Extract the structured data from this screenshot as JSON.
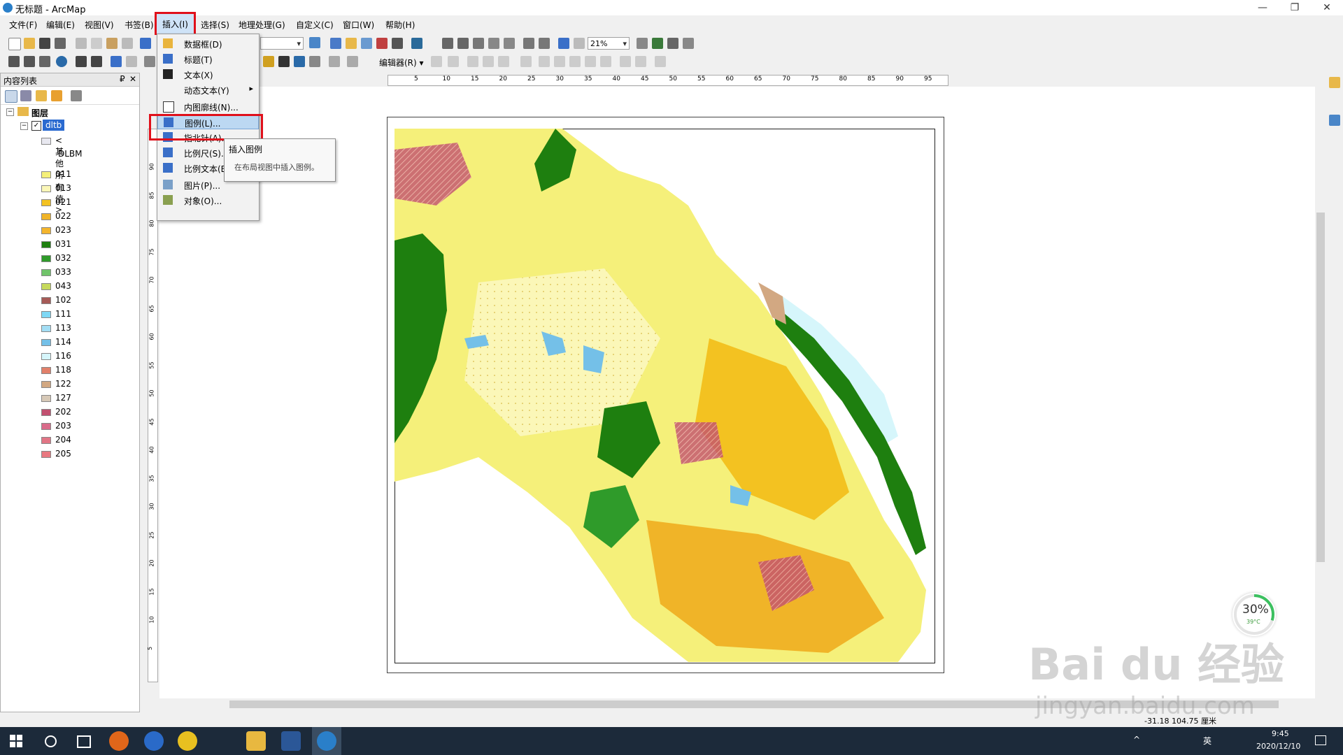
{
  "window": {
    "title": "无标题 - ArcMap",
    "min": "—",
    "max": "❐",
    "close": "✕"
  },
  "menubar": [
    "文件(F)",
    "编辑(E)",
    "视图(V)",
    "书签(B)",
    "插入(I)",
    "选择(S)",
    "地理处理(G)",
    "自定义(C)",
    "窗口(W)",
    "帮助(H)"
  ],
  "toolbar": {
    "scale": "21%",
    "editor": "编辑器(R) ▾"
  },
  "toc": {
    "title": "内容列表",
    "pin": "₽",
    "close": "✕",
    "layers_label": "图层",
    "layer_name": "dltb",
    "other_values": "<其他所有值>",
    "field": "DLBM",
    "classes": [
      {
        "code": "011",
        "color": "#f5f07a"
      },
      {
        "code": "013",
        "color": "#fbf7b8"
      },
      {
        "code": "021",
        "color": "#f3c221"
      },
      {
        "code": "022",
        "color": "#f0b428"
      },
      {
        "code": "023",
        "color": "#f4b52c"
      },
      {
        "code": "031",
        "color": "#1e7f0f"
      },
      {
        "code": "032",
        "color": "#2f9b2a"
      },
      {
        "code": "033",
        "color": "#70c46a"
      },
      {
        "code": "043",
        "color": "#c6d95b"
      },
      {
        "code": "102",
        "color": "#a65a57"
      },
      {
        "code": "111",
        "color": "#7fd8f5"
      },
      {
        "code": "113",
        "color": "#a3def5"
      },
      {
        "code": "114",
        "color": "#74c0e8"
      },
      {
        "code": "116",
        "color": "#d6f6fb"
      },
      {
        "code": "118",
        "color": "#e2806a"
      },
      {
        "code": "122",
        "color": "#d2a882"
      },
      {
        "code": "127",
        "color": "#d7c9b7"
      },
      {
        "code": "202",
        "color": "#c25070"
      },
      {
        "code": "203",
        "color": "#d96b8a"
      },
      {
        "code": "204",
        "color": "#e27585"
      },
      {
        "code": "205",
        "color": "#e87880"
      }
    ]
  },
  "insert_menu": {
    "items": [
      {
        "label": "数据框(D)",
        "icon": "data-frame-icon",
        "color": "#e9b43d"
      },
      {
        "label": "标题(T)",
        "icon": "title-icon",
        "color": "#3a6fc8"
      },
      {
        "label": "文本(X)",
        "icon": "text-icon",
        "color": "#222"
      },
      {
        "label": "动态文本(Y)",
        "icon": "",
        "color": "#f2f2f2",
        "submenu": "▸"
      },
      {
        "label": "内图廓线(N)...",
        "icon": "neatline-icon",
        "color": "#fff"
      },
      {
        "label": "图例(L)...",
        "icon": "legend-icon",
        "color": "#3a6fc8"
      },
      {
        "label": "指北针(A)...",
        "icon": "north-arrow-icon",
        "color": "#3a6fc8"
      },
      {
        "label": "比例尺(S)...",
        "icon": "scale-bar-icon",
        "color": "#3a6fc8"
      },
      {
        "label": "比例文本(E)...",
        "icon": "scale-text-icon",
        "color": "#3a6fc8"
      },
      {
        "label": "图片(P)...",
        "icon": "picture-icon",
        "color": "#7aa0c8"
      },
      {
        "label": "对象(O)...",
        "icon": "object-icon",
        "color": "#8aa050"
      }
    ]
  },
  "tooltip": {
    "title": "插入图例",
    "body": "在布局视图中插入图例。"
  },
  "ruler_ticks": [
    "5",
    "10",
    "15",
    "20",
    "25",
    "30",
    "35",
    "40",
    "45",
    "50",
    "55",
    "60",
    "65",
    "70",
    "75",
    "80",
    "85",
    "90",
    "95"
  ],
  "vruler_ticks": [
    "90",
    "85",
    "80",
    "75",
    "70",
    "65",
    "60",
    "55",
    "50",
    "45",
    "40",
    "35",
    "30",
    "25",
    "20",
    "15",
    "10",
    "5"
  ],
  "status": {
    "coords": "-31.18  104.75 厘米"
  },
  "gauge": {
    "value": "30%",
    "temp": "39°C",
    "fraction": 0.3
  },
  "watermark": {
    "brand": "Bai du 经验",
    "url": "jingyan.baidu.com"
  },
  "clock": {
    "time": "9:45",
    "date": "2020/12/10",
    "lang": "英"
  }
}
